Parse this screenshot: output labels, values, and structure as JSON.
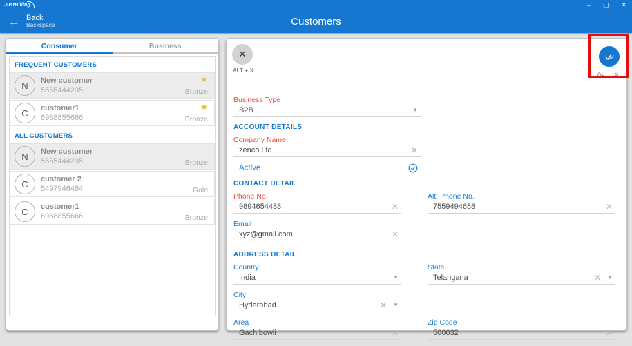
{
  "colors": {
    "header_blue": "#1577d0",
    "accent_blue": "#1a80d6",
    "required_red": "#e45341",
    "star_gold": "#e8b42a",
    "highlight_red": "#e30f0f"
  },
  "icons": {
    "back_arrow": "←",
    "minimize": "–",
    "maximize": "▢",
    "close": "✕",
    "star": "★",
    "clear": "✕",
    "dropdown": "▼",
    "close_form": "✕"
  },
  "window": {
    "logo": "JustBilling"
  },
  "header": {
    "back_label": "Back",
    "back_shortcut": "Backspace",
    "title": "Customers"
  },
  "left_panel": {
    "tabs": [
      {
        "label": "Consumer"
      },
      {
        "label": "Business"
      }
    ],
    "sections": [
      {
        "title": "FREQUENT CUSTOMERS",
        "items": [
          {
            "initial": "N",
            "name": "New customer",
            "phone": "5555444235",
            "tier": "Bronze"
          },
          {
            "initial": "C",
            "name": "customer1",
            "phone": "6988855666",
            "tier": "Bronze"
          }
        ]
      },
      {
        "title": "ALL CUSTOMERS",
        "items": [
          {
            "initial": "N",
            "name": "New customer",
            "phone": "5555444235",
            "tier": "Bronze"
          },
          {
            "initial": "C",
            "name": "customer 2",
            "phone": "5497946484",
            "tier": "Gold"
          },
          {
            "initial": "C",
            "name": "customer1",
            "phone": "6988855666",
            "tier": "Bronze"
          }
        ]
      }
    ]
  },
  "form": {
    "close_shortcut": "ALT + X",
    "save_shortcut": "ALT + S",
    "section_account": "ACCOUNT DETAILS",
    "section_contact": "CONTACT DETAIL",
    "section_address": "ADDRESS DETAIL",
    "fields": {
      "business_type": {
        "label": "Business Type",
        "value": "B2B"
      },
      "company_name": {
        "label": "Company Name",
        "value": "zenco Ltd"
      },
      "active": {
        "label": "Active"
      },
      "phone": {
        "label": "Phone No.",
        "value": "9894654488"
      },
      "alt_phone": {
        "label": "Alt. Phone No.",
        "value": "7559494658"
      },
      "email": {
        "label": "Email",
        "value": "xyz@gmail.com"
      },
      "country": {
        "label": "Country",
        "value": "India"
      },
      "state": {
        "label": "State",
        "value": "Telangana"
      },
      "city": {
        "label": "City",
        "value": "Hyderabad"
      },
      "area": {
        "label": "Area",
        "value": "Gachibowli"
      },
      "zip": {
        "label": "Zip Code",
        "value": "500032"
      }
    }
  }
}
